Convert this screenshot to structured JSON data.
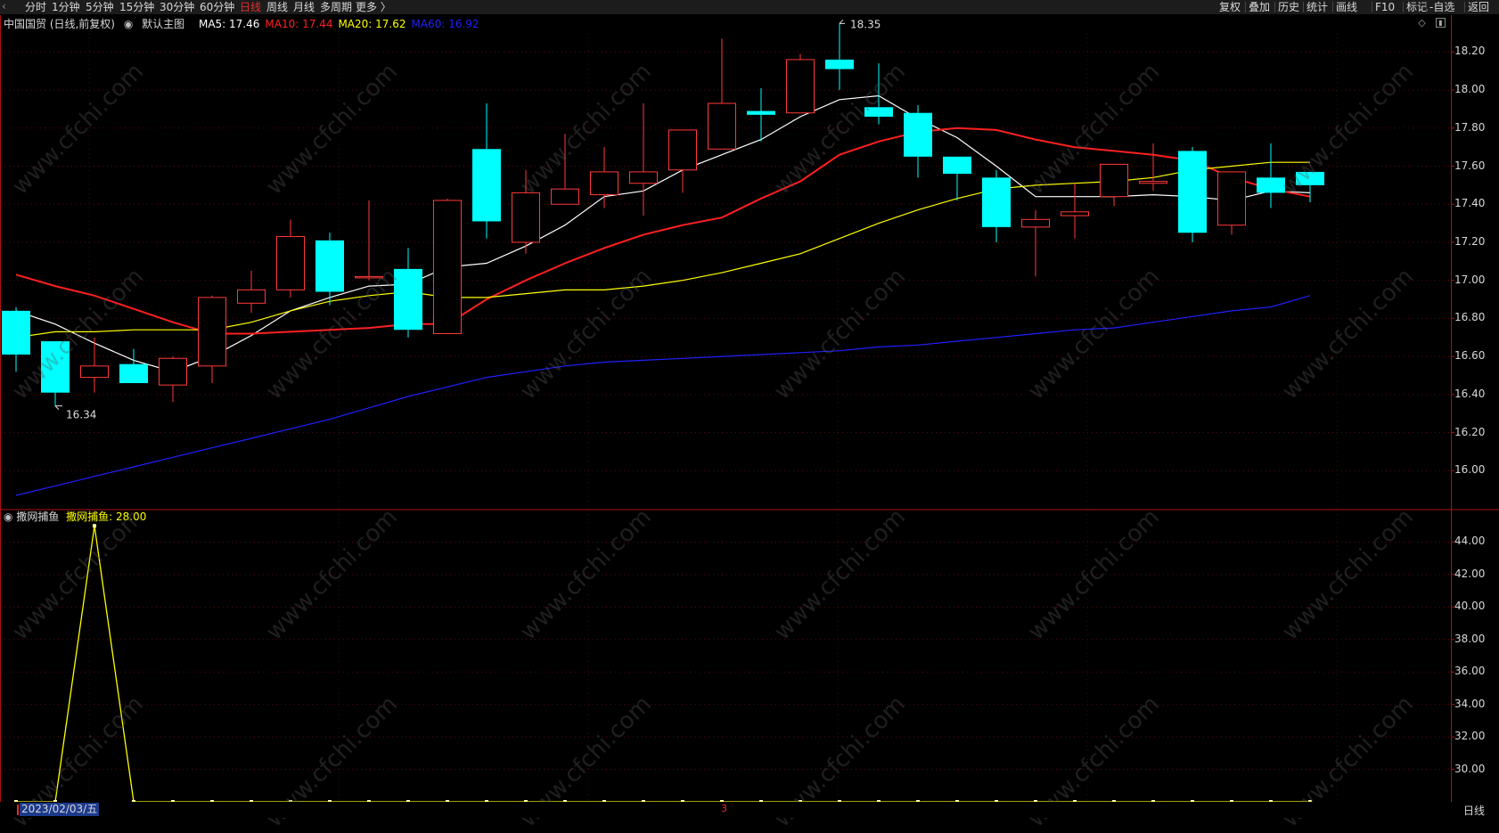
{
  "toolbar": {
    "left_items": [
      {
        "label": "分时",
        "active": false
      },
      {
        "label": "1分钟",
        "active": false
      },
      {
        "label": "5分钟",
        "active": false
      },
      {
        "label": "15分钟",
        "active": false
      },
      {
        "label": "30分钟",
        "active": false
      },
      {
        "label": "60分钟",
        "active": false
      },
      {
        "label": "日线",
        "active": true
      },
      {
        "label": "周线",
        "active": false
      },
      {
        "label": "月线",
        "active": false
      },
      {
        "label": "多周期",
        "active": false
      },
      {
        "label": "更多 〉",
        "active": false
      }
    ],
    "right_items": [
      "复权",
      "叠加",
      "历史",
      "统计",
      "画线",
      "F10",
      "标记",
      "-自选",
      "返回"
    ]
  },
  "main_chart": {
    "title": "中国国贸 (日线,前复权)",
    "indicator_name": "默认主图",
    "ma_labels": [
      {
        "text": "MA5: 17.46",
        "color": "#ffffff"
      },
      {
        "text": "MA10: 17.44",
        "color": "#ff2020"
      },
      {
        "text": "MA20: 17.62",
        "color": "#ffff00"
      },
      {
        "text": "MA60: 16.92",
        "color": "#2020ff"
      }
    ],
    "high_marker": "18.35",
    "low_marker": "16.34",
    "yticks": [
      "18.20",
      "18.00",
      "17.80",
      "17.60",
      "17.40",
      "17.20",
      "17.00",
      "16.80",
      "16.60",
      "16.40",
      "16.20",
      "16.00"
    ]
  },
  "indicator_chart": {
    "name": "撒网捕鱼",
    "value_label": "撒网捕鱼: 28.00",
    "yticks": [
      "44.00",
      "42.00",
      "40.00",
      "38.00",
      "36.00",
      "34.00",
      "32.00",
      "30.00"
    ]
  },
  "bottom": {
    "date_label": "2023/02/03/五",
    "month_marker": "3",
    "period": "日线"
  },
  "watermark_text": "www.cfchi.com",
  "chart_data": [
    {
      "type": "candlestick",
      "title": "中国国贸 (日线,前复权)",
      "ylim": [
        15.8,
        18.3
      ],
      "up_color": "#ff3a3a",
      "down_color": "#00ffff",
      "candles": [
        {
          "o": 16.84,
          "h": 16.86,
          "l": 16.52,
          "c": 16.61
        },
        {
          "o": 16.68,
          "h": 16.68,
          "l": 16.34,
          "c": 16.41
        },
        {
          "o": 16.49,
          "h": 16.7,
          "l": 16.41,
          "c": 16.55
        },
        {
          "o": 16.56,
          "h": 16.64,
          "l": 16.46,
          "c": 16.46
        },
        {
          "o": 16.45,
          "h": 16.6,
          "l": 16.36,
          "c": 16.59
        },
        {
          "o": 16.55,
          "h": 16.92,
          "l": 16.46,
          "c": 16.91
        },
        {
          "o": 16.88,
          "h": 17.05,
          "l": 16.83,
          "c": 16.95
        },
        {
          "o": 16.95,
          "h": 17.32,
          "l": 16.91,
          "c": 17.23
        },
        {
          "o": 17.21,
          "h": 17.25,
          "l": 16.87,
          "c": 16.94
        },
        {
          "o": 17.02,
          "h": 17.42,
          "l": 17.0,
          "c": 17.02
        },
        {
          "o": 17.06,
          "h": 17.17,
          "l": 16.7,
          "c": 16.74
        },
        {
          "o": 16.72,
          "h": 17.43,
          "l": 16.72,
          "c": 17.42
        },
        {
          "o": 17.69,
          "h": 17.93,
          "l": 17.22,
          "c": 17.31
        },
        {
          "o": 17.2,
          "h": 17.58,
          "l": 17.14,
          "c": 17.46
        },
        {
          "o": 17.4,
          "h": 17.77,
          "l": 17.4,
          "c": 17.48
        },
        {
          "o": 17.45,
          "h": 17.7,
          "l": 17.38,
          "c": 17.57
        },
        {
          "o": 17.51,
          "h": 17.93,
          "l": 17.34,
          "c": 17.57
        },
        {
          "o": 17.58,
          "h": 17.79,
          "l": 17.46,
          "c": 17.79
        },
        {
          "o": 17.69,
          "h": 18.27,
          "l": 17.69,
          "c": 17.93
        },
        {
          "o": 17.89,
          "h": 18.01,
          "l": 17.73,
          "c": 17.87
        },
        {
          "o": 17.88,
          "h": 18.19,
          "l": 17.88,
          "c": 18.16
        },
        {
          "o": 18.16,
          "h": 18.35,
          "l": 18.0,
          "c": 18.11
        },
        {
          "o": 17.91,
          "h": 18.14,
          "l": 17.82,
          "c": 17.86
        },
        {
          "o": 17.88,
          "h": 17.92,
          "l": 17.54,
          "c": 17.65
        },
        {
          "o": 17.65,
          "h": 17.65,
          "l": 17.42,
          "c": 17.56
        },
        {
          "o": 17.54,
          "h": 17.58,
          "l": 17.2,
          "c": 17.28
        },
        {
          "o": 17.28,
          "h": 17.37,
          "l": 17.02,
          "c": 17.32
        },
        {
          "o": 17.34,
          "h": 17.51,
          "l": 17.22,
          "c": 17.36
        },
        {
          "o": 17.44,
          "h": 17.61,
          "l": 17.39,
          "c": 17.61
        },
        {
          "o": 17.51,
          "h": 17.72,
          "l": 17.47,
          "c": 17.52
        },
        {
          "o": 17.68,
          "h": 17.7,
          "l": 17.2,
          "c": 17.25
        },
        {
          "o": 17.29,
          "h": 17.57,
          "l": 17.24,
          "c": 17.57
        },
        {
          "o": 17.54,
          "h": 17.72,
          "l": 17.38,
          "c": 17.46
        },
        {
          "o": 17.57,
          "h": 17.57,
          "l": 17.41,
          "c": 17.5
        }
      ],
      "series": [
        {
          "name": "MA5",
          "color": "#ffffff",
          "values": [
            16.84,
            16.77,
            16.67,
            16.58,
            16.52,
            16.6,
            16.71,
            16.84,
            16.91,
            16.97,
            16.98,
            17.07,
            17.09,
            17.18,
            17.29,
            17.44,
            17.47,
            17.58,
            17.66,
            17.74,
            17.86,
            17.95,
            17.97,
            17.85,
            17.75,
            17.6,
            17.44,
            17.44,
            17.44,
            17.45,
            17.44,
            17.42,
            17.47,
            17.46
          ]
        },
        {
          "name": "MA10",
          "color": "#ff2020",
          "values": [
            17.03,
            16.97,
            16.92,
            16.85,
            16.78,
            16.72,
            16.72,
            16.73,
            16.74,
            16.75,
            16.77,
            16.77,
            16.9,
            17.0,
            17.09,
            17.17,
            17.24,
            17.29,
            17.33,
            17.43,
            17.52,
            17.66,
            17.73,
            17.78,
            17.8,
            17.79,
            17.74,
            17.7,
            17.68,
            17.66,
            17.63,
            17.54,
            17.48,
            17.44
          ]
        },
        {
          "name": "MA20",
          "color": "#ffff00",
          "values": [
            16.7,
            16.73,
            16.73,
            16.74,
            16.74,
            16.74,
            16.78,
            16.84,
            16.89,
            16.92,
            16.94,
            16.91,
            16.91,
            16.93,
            16.95,
            16.95,
            16.97,
            17.0,
            17.04,
            17.09,
            17.14,
            17.22,
            17.3,
            17.37,
            17.43,
            17.48,
            17.5,
            17.51,
            17.52,
            17.54,
            17.58,
            17.6,
            17.62,
            17.62
          ]
        },
        {
          "name": "MA60",
          "color": "#2020ff",
          "values": [
            15.87,
            15.92,
            15.97,
            16.02,
            16.07,
            16.12,
            16.17,
            16.22,
            16.27,
            16.33,
            16.39,
            16.44,
            16.49,
            16.52,
            16.55,
            16.57,
            16.58,
            16.59,
            16.6,
            16.61,
            16.62,
            16.63,
            16.65,
            16.66,
            16.68,
            16.7,
            16.72,
            16.74,
            16.75,
            16.78,
            16.81,
            16.84,
            16.86,
            16.92
          ]
        }
      ]
    },
    {
      "type": "line",
      "title": "撒网捕鱼",
      "ylim": [
        28.0,
        46.0
      ],
      "series": [
        {
          "name": "撒网捕鱼",
          "color": "#ffff00",
          "values": [
            28.0,
            28.0,
            45.0,
            28.0,
            28.0,
            28.0,
            28.0,
            28.0,
            28.0,
            28.0,
            28.0,
            28.0,
            28.0,
            28.0,
            28.0,
            28.0,
            28.0,
            28.0,
            28.0,
            28.0,
            28.0,
            28.0,
            28.0,
            28.0,
            28.0,
            28.0,
            28.0,
            28.0,
            28.0,
            28.0,
            28.0,
            28.0,
            28.0,
            28.0
          ]
        }
      ]
    }
  ]
}
